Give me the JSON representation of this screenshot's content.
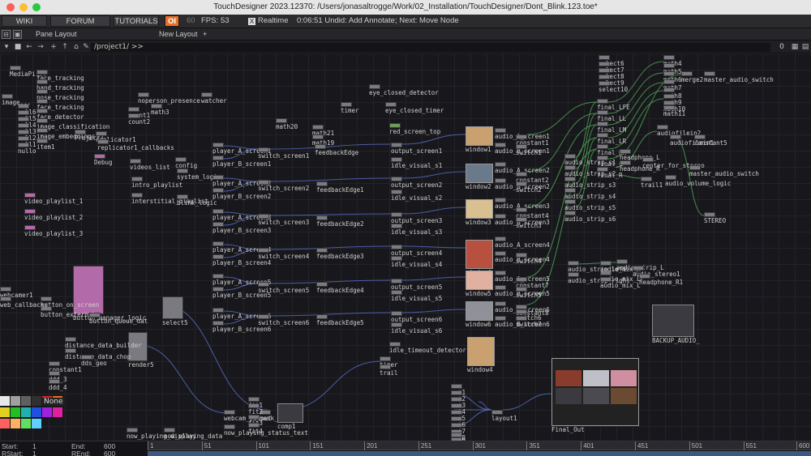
{
  "window": {
    "title": "TouchDesigner 2023.12370: /Users/jonasaltrogge/Work/02_Installation/TouchDesigner/Dont_Blink.123.toe*"
  },
  "menubar": {
    "wiki": "WIKI",
    "forum": "FORUM",
    "tutorials": "TUTORIALS",
    "oi": "OI",
    "fps_target": "60",
    "fps_label": "FPS:",
    "fps_value": "53",
    "realtime_check": "X",
    "realtime": "Realtime",
    "status": "0:06:51 Undid: Add Annotate; Next: Move Node"
  },
  "panebar": {
    "pane_layout": "Pane Layout",
    "new_layout": "New Layout",
    "plus": "+"
  },
  "pathbar": {
    "path": "/project1/ >>",
    "right_value": "0"
  },
  "nodes": [
    {
      "label": "MediaPi...",
      "kind": "grey"
    },
    {
      "label": "face_tracking",
      "kind": "grey"
    },
    {
      "label": "hand_tracking",
      "kind": "grey"
    },
    {
      "label": "pose_tracking",
      "kind": "grey"
    },
    {
      "label": "face_tracking",
      "kind": "grey"
    },
    {
      "label": "face_detector",
      "kind": "grey"
    },
    {
      "label": "image_classification",
      "kind": "grey"
    },
    {
      "label": "image_embeddings",
      "kind": "grey"
    },
    {
      "label": "item1",
      "kind": "grey"
    },
    {
      "label": "null6",
      "kind": "grey"
    },
    {
      "label": "null5",
      "kind": "grey"
    },
    {
      "label": "null4",
      "kind": "grey"
    },
    {
      "label": "null3",
      "kind": "grey"
    },
    {
      "label": "null2",
      "kind": "grey"
    },
    {
      "label": "null1",
      "kind": "grey"
    },
    {
      "label": "nullo",
      "kind": "grey"
    },
    {
      "label": "image...",
      "kind": "grey"
    },
    {
      "label": "noperson_presence",
      "kind": "grey"
    },
    {
      "label": "watcher",
      "kind": "grey"
    },
    {
      "label": "count1",
      "kind": "grey"
    },
    {
      "label": "count2",
      "kind": "grey"
    },
    {
      "label": "math3",
      "kind": "grey"
    },
    {
      "label": "Project1",
      "kind": "grey"
    },
    {
      "label": "replicator1",
      "kind": "grey"
    },
    {
      "label": "replicator1_callbacks",
      "kind": "grey"
    },
    {
      "label": "Debug",
      "kind": "pink"
    },
    {
      "label": "videos_list",
      "kind": "grey"
    },
    {
      "label": "config",
      "kind": "grey"
    },
    {
      "label": "system_logic",
      "kind": "grey"
    },
    {
      "label": "intro_playlist",
      "kind": "grey"
    },
    {
      "label": "interstitial_playlist",
      "kind": "grey"
    },
    {
      "label": "blink_logic",
      "kind": "grey"
    },
    {
      "label": "player_A_screen1",
      "kind": "grey"
    },
    {
      "label": "player_B_screen1",
      "kind": "grey"
    },
    {
      "label": "player_A_screen2",
      "kind": "grey"
    },
    {
      "label": "player_B_screen2",
      "kind": "grey"
    },
    {
      "label": "player_A_screen3",
      "kind": "grey"
    },
    {
      "label": "player_B_screen3",
      "kind": "grey"
    },
    {
      "label": "player_A_screen4",
      "kind": "grey"
    },
    {
      "label": "player_B_screen4",
      "kind": "grey"
    },
    {
      "label": "player_A_screen5",
      "kind": "grey"
    },
    {
      "label": "player_B_screen5",
      "kind": "grey"
    },
    {
      "label": "player_A_screen6",
      "kind": "grey"
    },
    {
      "label": "player_B_screen6",
      "kind": "grey"
    },
    {
      "label": "switch_screen1",
      "kind": "grey"
    },
    {
      "label": "switch_screen2",
      "kind": "grey"
    },
    {
      "label": "switch_screen3",
      "kind": "grey"
    },
    {
      "label": "switch_screen4",
      "kind": "grey"
    },
    {
      "label": "switch_screen5",
      "kind": "grey"
    },
    {
      "label": "switch_screen6",
      "kind": "grey"
    },
    {
      "label": "math20",
      "kind": "grey"
    },
    {
      "label": "math21",
      "kind": "grey"
    },
    {
      "label": "math19",
      "kind": "grey"
    },
    {
      "label": "timer",
      "kind": "grey"
    },
    {
      "label": "feedbackEdge",
      "kind": "grey"
    },
    {
      "label": "feedbackEdge1",
      "kind": "grey"
    },
    {
      "label": "feedbackEdge2",
      "kind": "grey"
    },
    {
      "label": "feedbackEdge3",
      "kind": "grey"
    },
    {
      "label": "feedbackEdge4",
      "kind": "grey"
    },
    {
      "label": "feedbackEdge5",
      "kind": "grey"
    },
    {
      "label": "eye_closed_detector",
      "kind": "grey"
    },
    {
      "label": "eye_closed_timer",
      "kind": "grey"
    },
    {
      "label": "red_screen_top",
      "kind": "green"
    },
    {
      "label": "output_screen1",
      "kind": "grey"
    },
    {
      "label": "output_screen2",
      "kind": "grey"
    },
    {
      "label": "output_screen3",
      "kind": "grey"
    },
    {
      "label": "output_screen4",
      "kind": "grey"
    },
    {
      "label": "output_screen5",
      "kind": "grey"
    },
    {
      "label": "output_screen6",
      "kind": "grey"
    },
    {
      "label": "idle_visual_s1",
      "kind": "grey"
    },
    {
      "label": "idle_visual_s2",
      "kind": "grey"
    },
    {
      "label": "idle_visual_s3",
      "kind": "grey"
    },
    {
      "label": "idle_visual_s4",
      "kind": "grey"
    },
    {
      "label": "idle_visual_s5",
      "kind": "grey"
    },
    {
      "label": "idle_visual_s6",
      "kind": "grey"
    },
    {
      "label": "idle_timeout_detector",
      "kind": "grey"
    },
    {
      "label": "window1",
      "kind": "grey"
    },
    {
      "label": "window2",
      "kind": "grey"
    },
    {
      "label": "window3",
      "kind": "grey"
    },
    {
      "label": "window4",
      "kind": "grey"
    },
    {
      "label": "window5",
      "kind": "grey"
    },
    {
      "label": "window6",
      "kind": "grey"
    },
    {
      "label": "window4",
      "kind": "grey"
    },
    {
      "label": "audio_A_screen1",
      "kind": "grey"
    },
    {
      "label": "audio_B_screen1",
      "kind": "grey"
    },
    {
      "label": "audio_A_screen2",
      "kind": "grey"
    },
    {
      "label": "audio_B_screen2",
      "kind": "grey"
    },
    {
      "label": "audio_A_screen3",
      "kind": "grey"
    },
    {
      "label": "audio_B_screen3",
      "kind": "grey"
    },
    {
      "label": "audio_A_screen4",
      "kind": "grey"
    },
    {
      "label": "audio_B_screen4",
      "kind": "grey"
    },
    {
      "label": "audio_A_screen5",
      "kind": "grey"
    },
    {
      "label": "audio_B_screen5",
      "kind": "grey"
    },
    {
      "label": "audio_A_screen6",
      "kind": "grey"
    },
    {
      "label": "audio_B_screen6",
      "kind": "grey"
    },
    {
      "label": "constant1",
      "kind": "grey"
    },
    {
      "label": "constant2",
      "kind": "grey"
    },
    {
      "label": "constant4",
      "kind": "grey"
    },
    {
      "label": "constant7",
      "kind": "grey"
    },
    {
      "label": "constant8",
      "kind": "grey"
    },
    {
      "label": "switch1",
      "kind": "grey"
    },
    {
      "label": "switch2",
      "kind": "grey"
    },
    {
      "label": "switch3",
      "kind": "grey"
    },
    {
      "label": "switch4",
      "kind": "grey"
    },
    {
      "label": "switch5",
      "kind": "grey"
    },
    {
      "label": "switch6",
      "kind": "grey"
    },
    {
      "label": "switch7",
      "kind": "grey"
    },
    {
      "label": "audio_strip_s1",
      "kind": "grey"
    },
    {
      "label": "audio_strip_s2",
      "kind": "grey"
    },
    {
      "label": "audio_strip_s3",
      "kind": "grey"
    },
    {
      "label": "audio_strip_s4",
      "kind": "grey"
    },
    {
      "label": "audio_strip_s5",
      "kind": "grey"
    },
    {
      "label": "audio_strip_s6",
      "kind": "grey"
    },
    {
      "label": "audio_strip_left",
      "kind": "grey"
    },
    {
      "label": "audio_strip_right",
      "kind": "grey"
    },
    {
      "label": "audio_mix_LF",
      "kind": "grey"
    },
    {
      "label": "audio_mix_L",
      "kind": "grey"
    },
    {
      "label": "audio_mix_R",
      "kind": "grey"
    },
    {
      "label": "select6",
      "kind": "grey"
    },
    {
      "label": "select7",
      "kind": "grey"
    },
    {
      "label": "select8",
      "kind": "grey"
    },
    {
      "label": "select9",
      "kind": "grey"
    },
    {
      "label": "select10",
      "kind": "grey"
    },
    {
      "label": "math4",
      "kind": "grey"
    },
    {
      "label": "math5",
      "kind": "grey"
    },
    {
      "label": "math6",
      "kind": "grey"
    },
    {
      "label": "math7",
      "kind": "grey"
    },
    {
      "label": "math8",
      "kind": "grey"
    },
    {
      "label": "math9",
      "kind": "grey"
    },
    {
      "label": "math10",
      "kind": "grey"
    },
    {
      "label": "math11",
      "kind": "grey"
    },
    {
      "label": "merge2",
      "kind": "grey"
    },
    {
      "label": "master_audio_switch",
      "kind": "grey"
    },
    {
      "label": "final_LFE",
      "kind": "grey"
    },
    {
      "label": "final_LL",
      "kind": "grey"
    },
    {
      "label": "final_LM",
      "kind": "grey"
    },
    {
      "label": "final_LR",
      "kind": "grey"
    },
    {
      "label": "final_RH",
      "kind": "grey"
    },
    {
      "label": "final_C",
      "kind": "grey"
    },
    {
      "label": "final_R",
      "kind": "grey"
    },
    {
      "label": "headphone_L",
      "kind": "grey"
    },
    {
      "label": "headphone_R",
      "kind": "grey"
    },
    {
      "label": "center_for_stereo",
      "kind": "grey"
    },
    {
      "label": "audiofilein2",
      "kind": "grey"
    },
    {
      "label": "audiofilein1",
      "kind": "grey"
    },
    {
      "label": "constant5",
      "kind": "grey"
    },
    {
      "label": "master_audio_switch",
      "kind": "grey"
    },
    {
      "label": "audio_volume_logic",
      "kind": "grey"
    },
    {
      "label": "trail1",
      "kind": "grey"
    },
    {
      "label": "STEREO",
      "kind": "grey"
    },
    {
      "label": "audio_strip_L",
      "kind": "grey"
    },
    {
      "label": "audio_stereo1",
      "kind": "grey"
    },
    {
      "label": "headphone_R1",
      "kind": "grey"
    },
    {
      "label": "BACKUP_AUDIO_",
      "kind": "dark"
    },
    {
      "label": "video_playlist_1",
      "kind": "pink"
    },
    {
      "label": "video_playlist_2",
      "kind": "pink"
    },
    {
      "label": "video_playlist_3",
      "kind": "pink"
    },
    {
      "label": "button_manager_logic",
      "kind": "pink"
    },
    {
      "label": "button_on_screen",
      "kind": "grey"
    },
    {
      "label": "button_external",
      "kind": "grey"
    },
    {
      "label": "button_queue_dat",
      "kind": "grey"
    },
    {
      "label": "select5",
      "kind": "grey"
    },
    {
      "label": "render5",
      "kind": "grey"
    },
    {
      "label": "distance_data_builder",
      "kind": "grey"
    },
    {
      "label": "distance_data_chop",
      "kind": "grey"
    },
    {
      "label": "dds_geo",
      "kind": "grey"
    },
    {
      "label": "constant1",
      "kind": "grey"
    },
    {
      "label": "ddd_3",
      "kind": "grey"
    },
    {
      "label": "ddd_4",
      "kind": "grey"
    },
    {
      "label": "webcam_output",
      "kind": "grey"
    },
    {
      "label": "mask_out",
      "kind": "grey"
    },
    {
      "label": "comp1",
      "kind": "dark"
    },
    {
      "label": "fit1",
      "kind": "grey"
    },
    {
      "label": "fit2",
      "kind": "grey"
    },
    {
      "label": "fit3",
      "kind": "grey"
    },
    {
      "label": "fit4",
      "kind": "grey"
    },
    {
      "label": "now_playing_display",
      "kind": "grey"
    },
    {
      "label": "now_playing_data",
      "kind": "grey"
    },
    {
      "label": "now_playing_status_text",
      "kind": "grey"
    },
    {
      "label": "timer",
      "kind": "grey"
    },
    {
      "label": "trail",
      "kind": "grey"
    },
    {
      "label": "layout1",
      "kind": "grey"
    },
    {
      "label": "Final_Out",
      "kind": "dark"
    },
    {
      "label": "out1",
      "kind": "grey"
    },
    {
      "label": "out2",
      "kind": "grey"
    },
    {
      "label": "out3",
      "kind": "grey"
    },
    {
      "label": "out4",
      "kind": "grey"
    },
    {
      "label": "out5",
      "kind": "grey"
    },
    {
      "label": "out6",
      "kind": "grey"
    },
    {
      "label": "out7",
      "kind": "grey"
    },
    {
      "label": "out8",
      "kind": "grey"
    },
    {
      "label": "out9",
      "kind": "grey"
    },
    {
      "label": "screen_10",
      "kind": "grey"
    },
    {
      "label": "webcamer1",
      "kind": "grey"
    },
    {
      "label": "web_callbacks",
      "kind": "grey"
    }
  ],
  "palette": {
    "none_label": "None",
    "colors": [
      "#e8e8e8",
      "#a0a0a0",
      "#606060",
      "#303030",
      "#e02020",
      "#e07020",
      "#e0d020",
      "#20c020",
      "#20b0b0",
      "#2050e0",
      "#a020e0",
      "#e020a0",
      "#ff6060",
      "#ffb060",
      "#60e060",
      "#60d0ff"
    ]
  },
  "timeline": {
    "start_label": "Start:",
    "start_value": "1",
    "end_label": "End:",
    "end_value": "600",
    "rstart_label": "RStart:",
    "rstart_value": "1",
    "rend_label": "REnd:",
    "rend_value": "600",
    "ticks": [
      "1",
      "51",
      "101",
      "151",
      "201",
      "251",
      "301",
      "351",
      "401",
      "451",
      "501",
      "551",
      "600"
    ]
  },
  "colors": {
    "accent_orange": "#e8702a",
    "node_grey": "#7a7a80",
    "node_pink": "#b36aa8",
    "node_green": "#6f9a5e",
    "wire_blue": "#5a6fc8",
    "wire_green": "#4fa055"
  }
}
